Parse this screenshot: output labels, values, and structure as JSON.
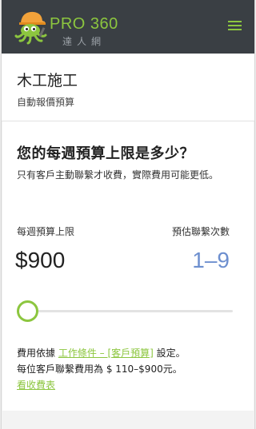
{
  "header": {
    "logo_text": "PRO 360",
    "logo_sub": "達人網",
    "colors": {
      "brand_green": "#8cc63f",
      "topbar": "#3a3f44"
    }
  },
  "service": {
    "title": "木工施工",
    "subtitle": "自動報價預算"
  },
  "budget": {
    "question": "您的每週預算上限是多少？",
    "description": "只有客戶主動聯繫才收費，實際費用可能更低。",
    "weekly_cap_label": "每週預算上限",
    "weekly_cap_value": "$900",
    "estimated_contacts_label": "預估聯繫次數",
    "estimated_contacts_value": "1–9",
    "slider_level": 0,
    "fine_print": {
      "line1_prefix": "費用依據 ",
      "line1_link": "工作條件 – [客戶預算]",
      "line1_suffix": " 設定。",
      "line2": "每位客戶聯繫費用為 $ 110–$900元。",
      "view_fees_link": "看收費表"
    },
    "colors": {
      "contacts_blue": "#6d8fcf"
    }
  }
}
